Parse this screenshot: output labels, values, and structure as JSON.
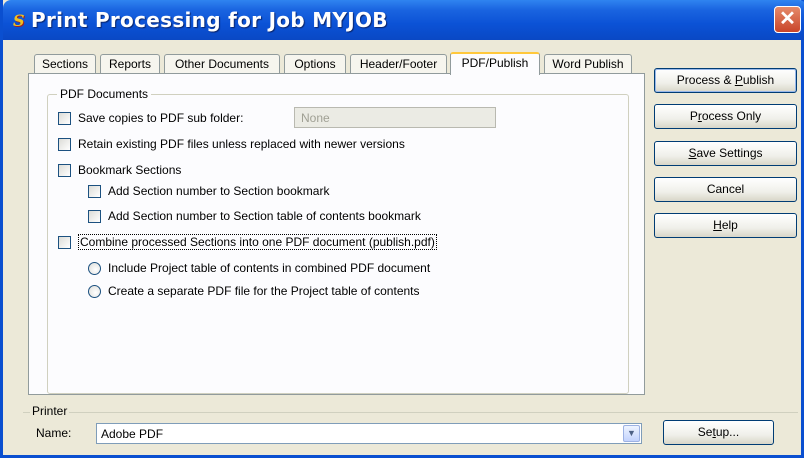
{
  "window": {
    "title": "Print Processing for Job MYJOB",
    "icon": "app-logo-icon",
    "close_glyph": "✕"
  },
  "tabs": [
    {
      "label": "Sections"
    },
    {
      "label": "Reports"
    },
    {
      "label": "Other Documents"
    },
    {
      "label": "Options"
    },
    {
      "label": "Header/Footer"
    },
    {
      "label": "PDF/Publish",
      "active": true
    },
    {
      "label": "Word Publish"
    }
  ],
  "pdf": {
    "group_label": "PDF Documents",
    "save_copies_label": "Save copies to PDF sub folder:",
    "subfolder_value": "None",
    "retain_label": "Retain existing PDF files unless replaced with newer versions",
    "bookmark_label": "Bookmark Sections",
    "bookmark_number_label": "Add Section number to Section bookmark",
    "toc_number_label": "Add Section number to Section table of contents bookmark",
    "combine_label": "Combine processed Sections into one PDF document (publish.pdf)",
    "include_toc_label": "Include Project table of contents in combined PDF document",
    "separate_toc_label": "Create a separate PDF file for the Project table of contents"
  },
  "buttons": {
    "process_publish_pre": "Process & ",
    "process_publish_ul": "P",
    "process_publish_post": "ublish",
    "process_only_pre": "P",
    "process_only_ul": "r",
    "process_only_post": "ocess Only",
    "save_settings_ul": "S",
    "save_settings_post": "ave Settings",
    "cancel": "Cancel",
    "help_ul": "H",
    "help_post": "elp"
  },
  "printer": {
    "group_label": "Printer",
    "name_label": "Name:",
    "selected": "Adobe PDF",
    "setup_ul": "t",
    "setup_pre": "Se",
    "setup_post": "up..."
  }
}
